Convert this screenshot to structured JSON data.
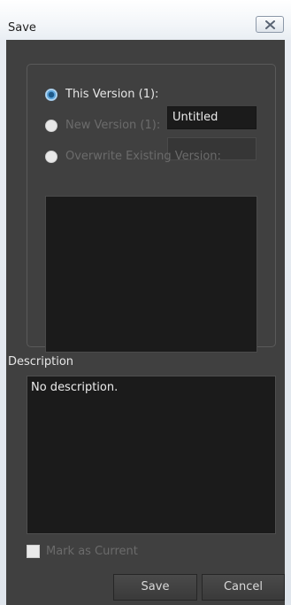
{
  "window": {
    "title": "Save"
  },
  "options": {
    "this_version": {
      "label": "This Version (1):",
      "selected": true
    },
    "new_version": {
      "label": "New Version (1):",
      "selected": false,
      "enabled": false
    },
    "overwrite": {
      "label": "Overwrite Existing Version:",
      "selected": false,
      "enabled": false
    }
  },
  "name_field": {
    "value": "Untitled"
  },
  "new_version_field": {
    "value": ""
  },
  "description": {
    "label": "Description",
    "value": "No description."
  },
  "mark_current": {
    "label": "Mark as Current",
    "checked": false,
    "enabled": false
  },
  "buttons": {
    "save": "Save",
    "cancel": "Cancel"
  },
  "colors": {
    "panel_bg": "#404040",
    "field_bg": "#1b1b1b",
    "accent_radio": "#5ea6dc",
    "disabled_text": "#6b6b6b",
    "text": "#e6e6e6"
  },
  "icons": {
    "close": "close-icon"
  }
}
